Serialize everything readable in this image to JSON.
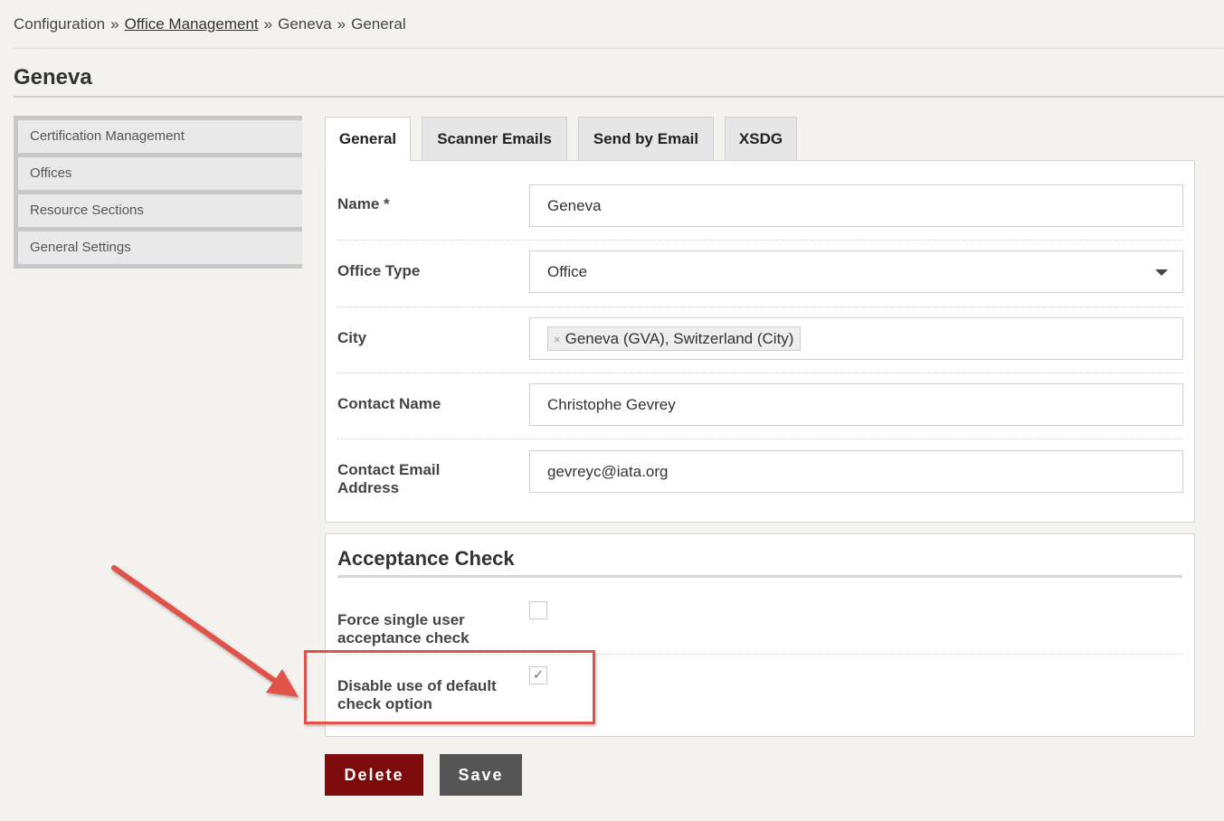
{
  "breadcrumb": {
    "item1": "Configuration",
    "sep": "»",
    "item2": "Office Management",
    "item3": "Geneva",
    "item4": "General"
  },
  "page_title": "Geneva",
  "sidebar": {
    "items": [
      {
        "label": "Certification Management"
      },
      {
        "label": "Offices"
      },
      {
        "label": "Resource Sections"
      },
      {
        "label": "General Settings"
      }
    ]
  },
  "tabs": [
    {
      "label": "General",
      "active": true
    },
    {
      "label": "Scanner Emails",
      "active": false
    },
    {
      "label": "Send by Email",
      "active": false
    },
    {
      "label": "XSDG",
      "active": false
    }
  ],
  "form": {
    "name": {
      "label": "Name *",
      "value": "Geneva"
    },
    "office_type": {
      "label": "Office Type",
      "value": "Office"
    },
    "city": {
      "label": "City",
      "token": "Geneva (GVA), Switzerland (City)",
      "remove_glyph": "×"
    },
    "contact_name": {
      "label": "Contact Name",
      "value": "Christophe Gevrey"
    },
    "contact_email": {
      "label": "Contact Email Address",
      "value": "gevreyc@iata.org"
    }
  },
  "acceptance": {
    "title": "Acceptance Check",
    "force_single": {
      "label": "Force single user acceptance check",
      "checked": false,
      "glyph": ""
    },
    "disable_default": {
      "label": "Disable use of default check option",
      "checked": true,
      "glyph": "✓"
    }
  },
  "actions": {
    "delete_label": "Delete",
    "save_label": "Save"
  },
  "colors": {
    "delete": "#7d0b0b",
    "save": "#555555",
    "annotation": "#e0524a"
  }
}
